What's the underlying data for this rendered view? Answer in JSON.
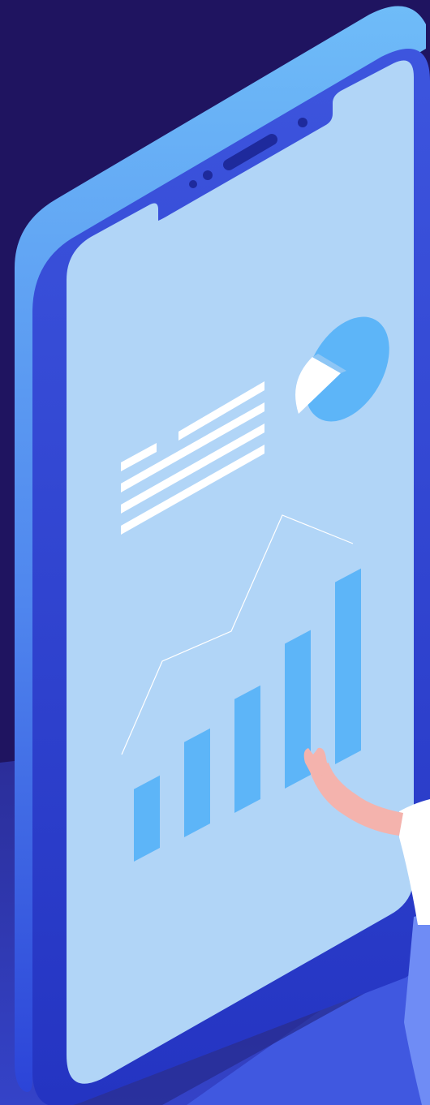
{
  "colors": {
    "background": "#1f1460",
    "floor": "#2c2f9a",
    "floor_highlight": "#3b4bd6",
    "phone_side": "#5aa2f5",
    "phone_body": "#2f45d6",
    "phone_body_dark": "#2233b8",
    "screen": "#b1d5f7",
    "accent": "#5db5f8",
    "white": "#ffffff",
    "skin": "#f4b3ad",
    "shirt": "#ffffff",
    "pants": "#6f8cf5"
  },
  "icons": [
    "pie-chart-icon",
    "text-lines-icon",
    "bar-chart-icon",
    "trend-line-icon"
  ],
  "bar_chart": {
    "bars": 5,
    "values_relative": [
      0.35,
      0.46,
      0.55,
      0.7,
      0.88
    ]
  }
}
